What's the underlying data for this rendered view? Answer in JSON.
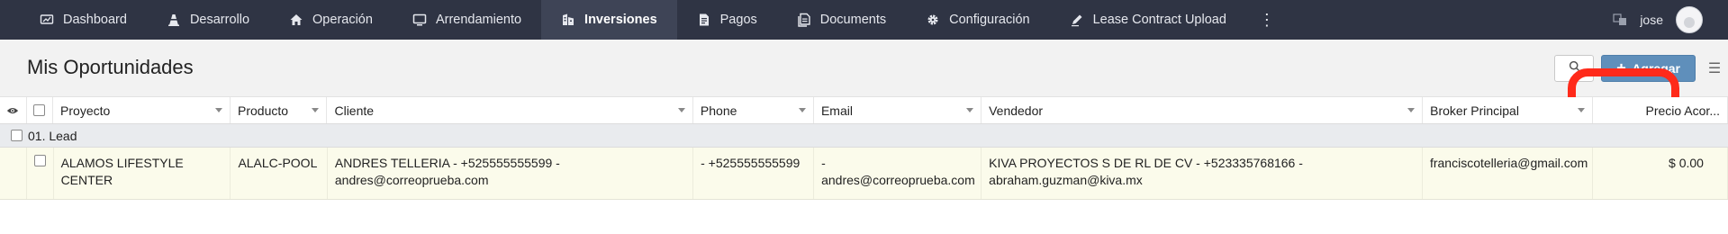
{
  "nav": {
    "items": [
      {
        "label": "Dashboard",
        "icon": "dashboard-icon",
        "active": false
      },
      {
        "label": "Desarrollo",
        "icon": "traffic-cone-icon",
        "active": false
      },
      {
        "label": "Operación",
        "icon": "home-icon",
        "active": false
      },
      {
        "label": "Arrendamiento",
        "icon": "monitor-icon",
        "active": false
      },
      {
        "label": "Inversiones",
        "icon": "building-icon",
        "active": true
      },
      {
        "label": "Pagos",
        "icon": "document-icon",
        "active": false
      },
      {
        "label": "Documents",
        "icon": "documents-icon",
        "active": false
      },
      {
        "label": "Configuración",
        "icon": "gear-icon",
        "active": false
      },
      {
        "label": "Lease Contract Upload",
        "icon": "pen-icon",
        "active": false
      }
    ],
    "more_icon": "more-vertical-icon",
    "user_name": "jose"
  },
  "page": {
    "title": "Mis Oportunidades",
    "add_label": "Agregar"
  },
  "table": {
    "columns": [
      "Proyecto",
      "Producto",
      "Cliente",
      "Phone",
      "Email",
      "Vendedor",
      "Broker Principal",
      "Precio Acor..."
    ],
    "group_label": "01. Lead",
    "rows": [
      {
        "proyecto": "ALAMOS LIFESTYLE CENTER",
        "producto": "ALALC-POOL",
        "cliente": "ANDRES TELLERIA - +525555555599 - andres@correoprueba.com",
        "phone": "- +525555555599",
        "email": "- andres@correoprueba.com",
        "vendedor": "KIVA PROYECTOS S DE RL DE CV - +523335768166 - abraham.guzman@kiva.mx",
        "broker": "franciscotelleria@gmail.com",
        "precio": "$ 0.00"
      }
    ]
  },
  "colors": {
    "nav_bg": "#2f3444",
    "nav_active": "#3e4456",
    "add_button": "#5f8fbb",
    "highlight": "#ff2a1a",
    "row_bg": "#fbfbeb"
  }
}
